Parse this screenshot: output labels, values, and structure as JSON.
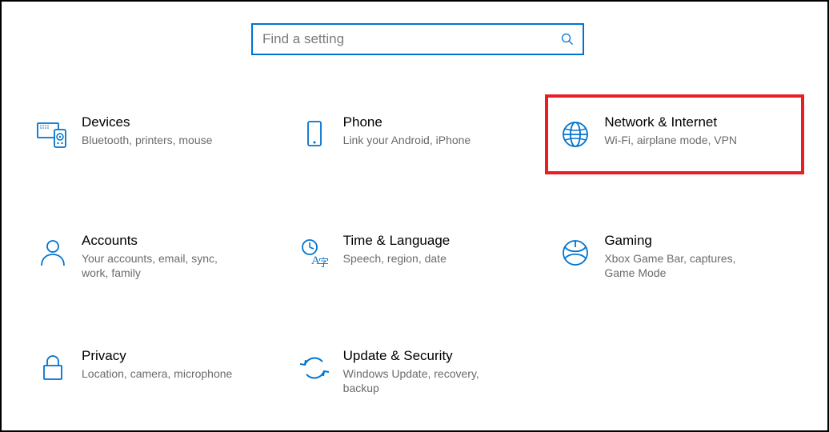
{
  "search": {
    "placeholder": "Find a setting"
  },
  "tiles": [
    {
      "title": "Devices",
      "sub": "Bluetooth, printers, mouse"
    },
    {
      "title": "Phone",
      "sub": "Link your Android, iPhone"
    },
    {
      "title": "Network & Internet",
      "sub": "Wi-Fi, airplane mode, VPN"
    },
    {
      "title": "Accounts",
      "sub": "Your accounts, email, sync, work, family"
    },
    {
      "title": "Time & Language",
      "sub": "Speech, region, date"
    },
    {
      "title": "Gaming",
      "sub": "Xbox Game Bar, captures, Game Mode"
    },
    {
      "title": "Privacy",
      "sub": "Location, camera, microphone"
    },
    {
      "title": "Update & Security",
      "sub": "Windows Update, recovery, backup"
    }
  ],
  "colors": {
    "accent": "#0073cf",
    "highlight": "#ec1c24"
  }
}
